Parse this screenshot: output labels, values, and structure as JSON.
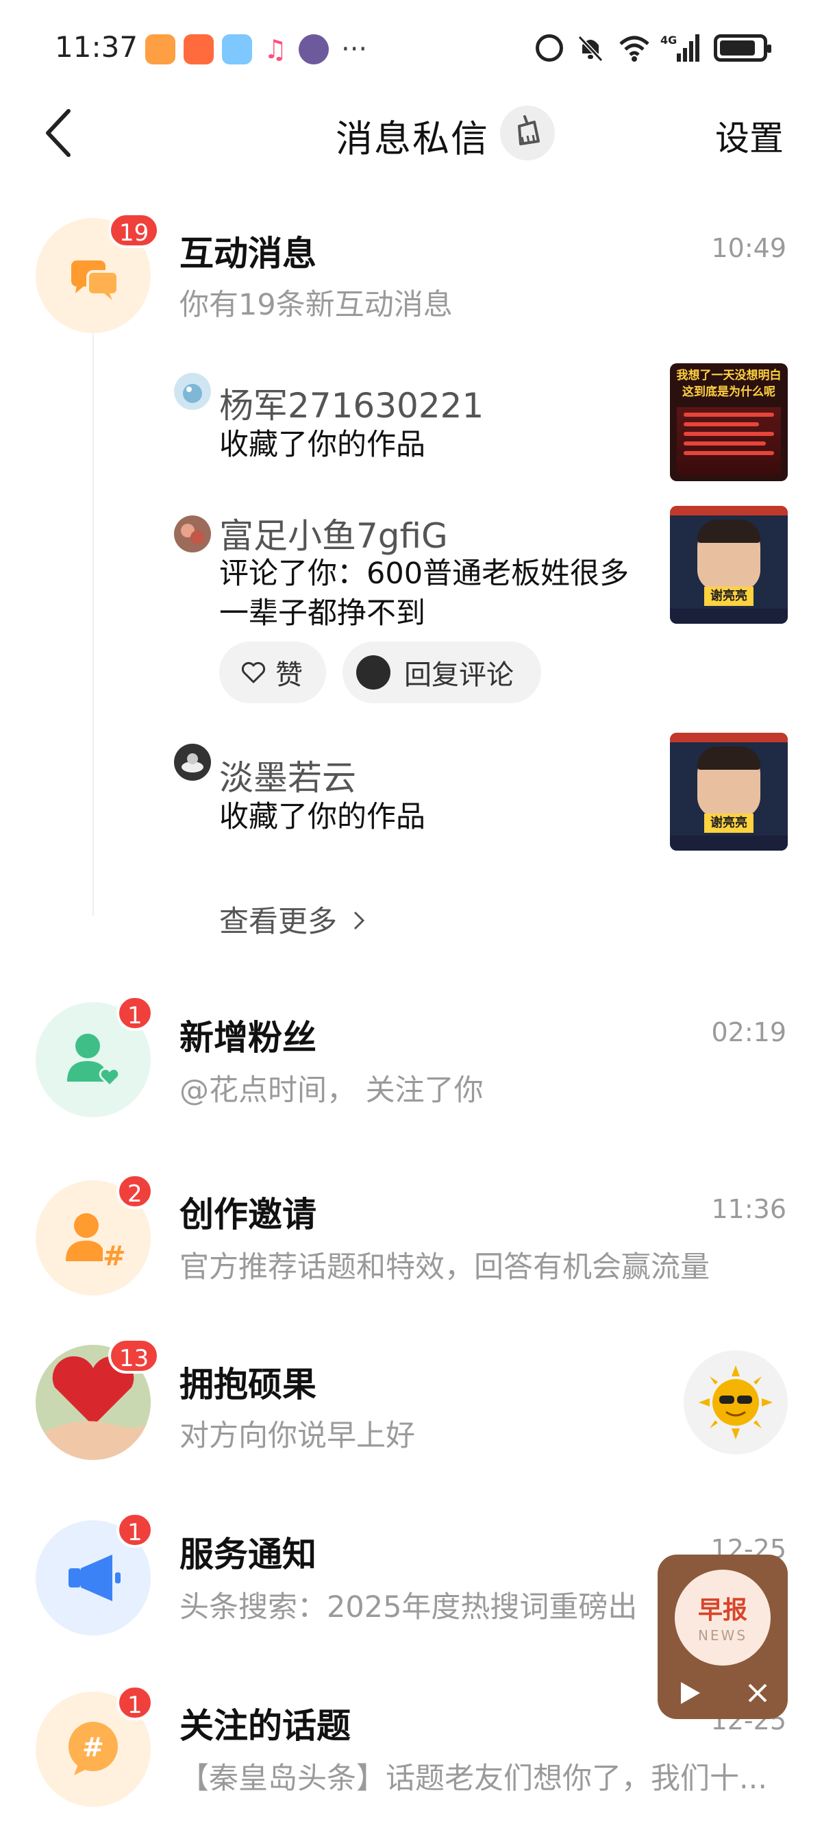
{
  "status_bar": {
    "time": "11:37",
    "more": "···",
    "network": "4G",
    "battery_level": 0.85
  },
  "nav": {
    "title": "消息私信",
    "settings": "设置"
  },
  "interaction": {
    "title": "互动消息",
    "time": "10:49",
    "subtitle": "你有19条新互动消息",
    "badge": "19",
    "items": [
      {
        "name": "杨军271630221",
        "text": "收藏了你的作品"
      },
      {
        "name": "富足小鱼7gfiG",
        "text": "评论了你：600普通老板姓很多一辈子都挣不到",
        "like_label": "赞",
        "reply_label": "回复评论"
      },
      {
        "name": "淡墨若云",
        "text": "收藏了你的作品"
      }
    ],
    "thumb1_lines": [
      "我想了一天没想明白",
      "这到底是为什么呢"
    ],
    "thumb_caption": "谢亮亮",
    "see_more": "查看更多"
  },
  "messages": [
    {
      "title": "新增粉丝",
      "time": "02:19",
      "subtitle": "@花点时间， 关注了你",
      "badge": "1"
    },
    {
      "title": "创作邀请",
      "time": "11:36",
      "subtitle": "官方推荐话题和特效，回答有机会赢流量",
      "badge": "2"
    },
    {
      "title": "拥抱硕果",
      "time": "",
      "subtitle": "对方向你说早上好",
      "badge": "13"
    },
    {
      "title": "服务通知",
      "time": "12-25",
      "subtitle": "头条搜索：2025年度热搜词重磅出",
      "badge": "1"
    },
    {
      "title": "关注的话题",
      "time": "12-25",
      "subtitle": "【秦皇岛头条】话题老友们想你了，我们十...",
      "badge": "1"
    }
  ],
  "news_widget": {
    "title_cn": "早报",
    "title_en": "NEWS"
  },
  "colors": {
    "badge": "#f0403c",
    "orange_icon": "#ff9b2f",
    "green_icon": "#3fbf88",
    "blue_icon": "#3b82f6"
  }
}
